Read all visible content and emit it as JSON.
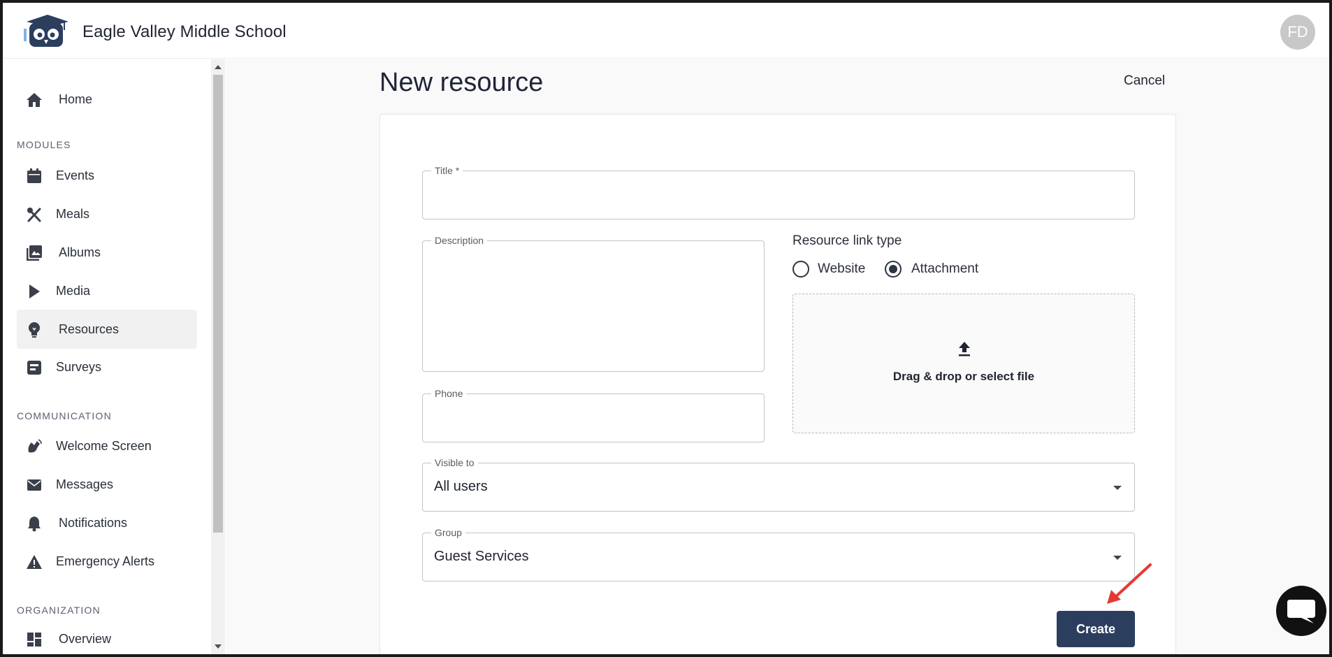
{
  "header": {
    "school_name": "Eagle Valley Middle School",
    "avatar_initials": "FD"
  },
  "sidebar": {
    "home": "Home",
    "sections": {
      "modules": "MODULES",
      "communication": "COMMUNICATION",
      "organization": "ORGANIZATION"
    },
    "modules": [
      {
        "label": "Events",
        "icon": "calendar-icon"
      },
      {
        "label": "Meals",
        "icon": "utensils-icon"
      },
      {
        "label": "Albums",
        "icon": "photo-library-icon"
      },
      {
        "label": "Media",
        "icon": "play-icon"
      },
      {
        "label": "Resources",
        "icon": "lightbulb-icon",
        "active": true
      },
      {
        "label": "Surveys",
        "icon": "survey-icon"
      }
    ],
    "communication": [
      {
        "label": "Welcome Screen",
        "icon": "wave-icon"
      },
      {
        "label": "Messages",
        "icon": "envelope-icon"
      },
      {
        "label": "Notifications",
        "icon": "bell-icon"
      },
      {
        "label": "Emergency Alerts",
        "icon": "warning-icon"
      }
    ],
    "organization": [
      {
        "label": "Overview",
        "icon": "dashboard-icon"
      }
    ]
  },
  "main": {
    "page_title": "New resource",
    "cancel_label": "Cancel",
    "form": {
      "title_label": "Title *",
      "title_value": "",
      "description_label": "Description",
      "description_value": "",
      "phone_label": "Phone",
      "phone_value": "",
      "link_type_label": "Resource link type",
      "link_type_options": [
        "Website",
        "Attachment"
      ],
      "link_type_selected": "Attachment",
      "dropzone_text": "Drag & drop or select file",
      "visible_to_label": "Visible to",
      "visible_to_value": "All users",
      "group_label": "Group",
      "group_value": "Guest Services",
      "create_label": "Create"
    }
  },
  "colors": {
    "primary_button": "#2c3e5e",
    "annotation_arrow": "#e53935",
    "active_nav_bg": "#f1f1f1"
  }
}
